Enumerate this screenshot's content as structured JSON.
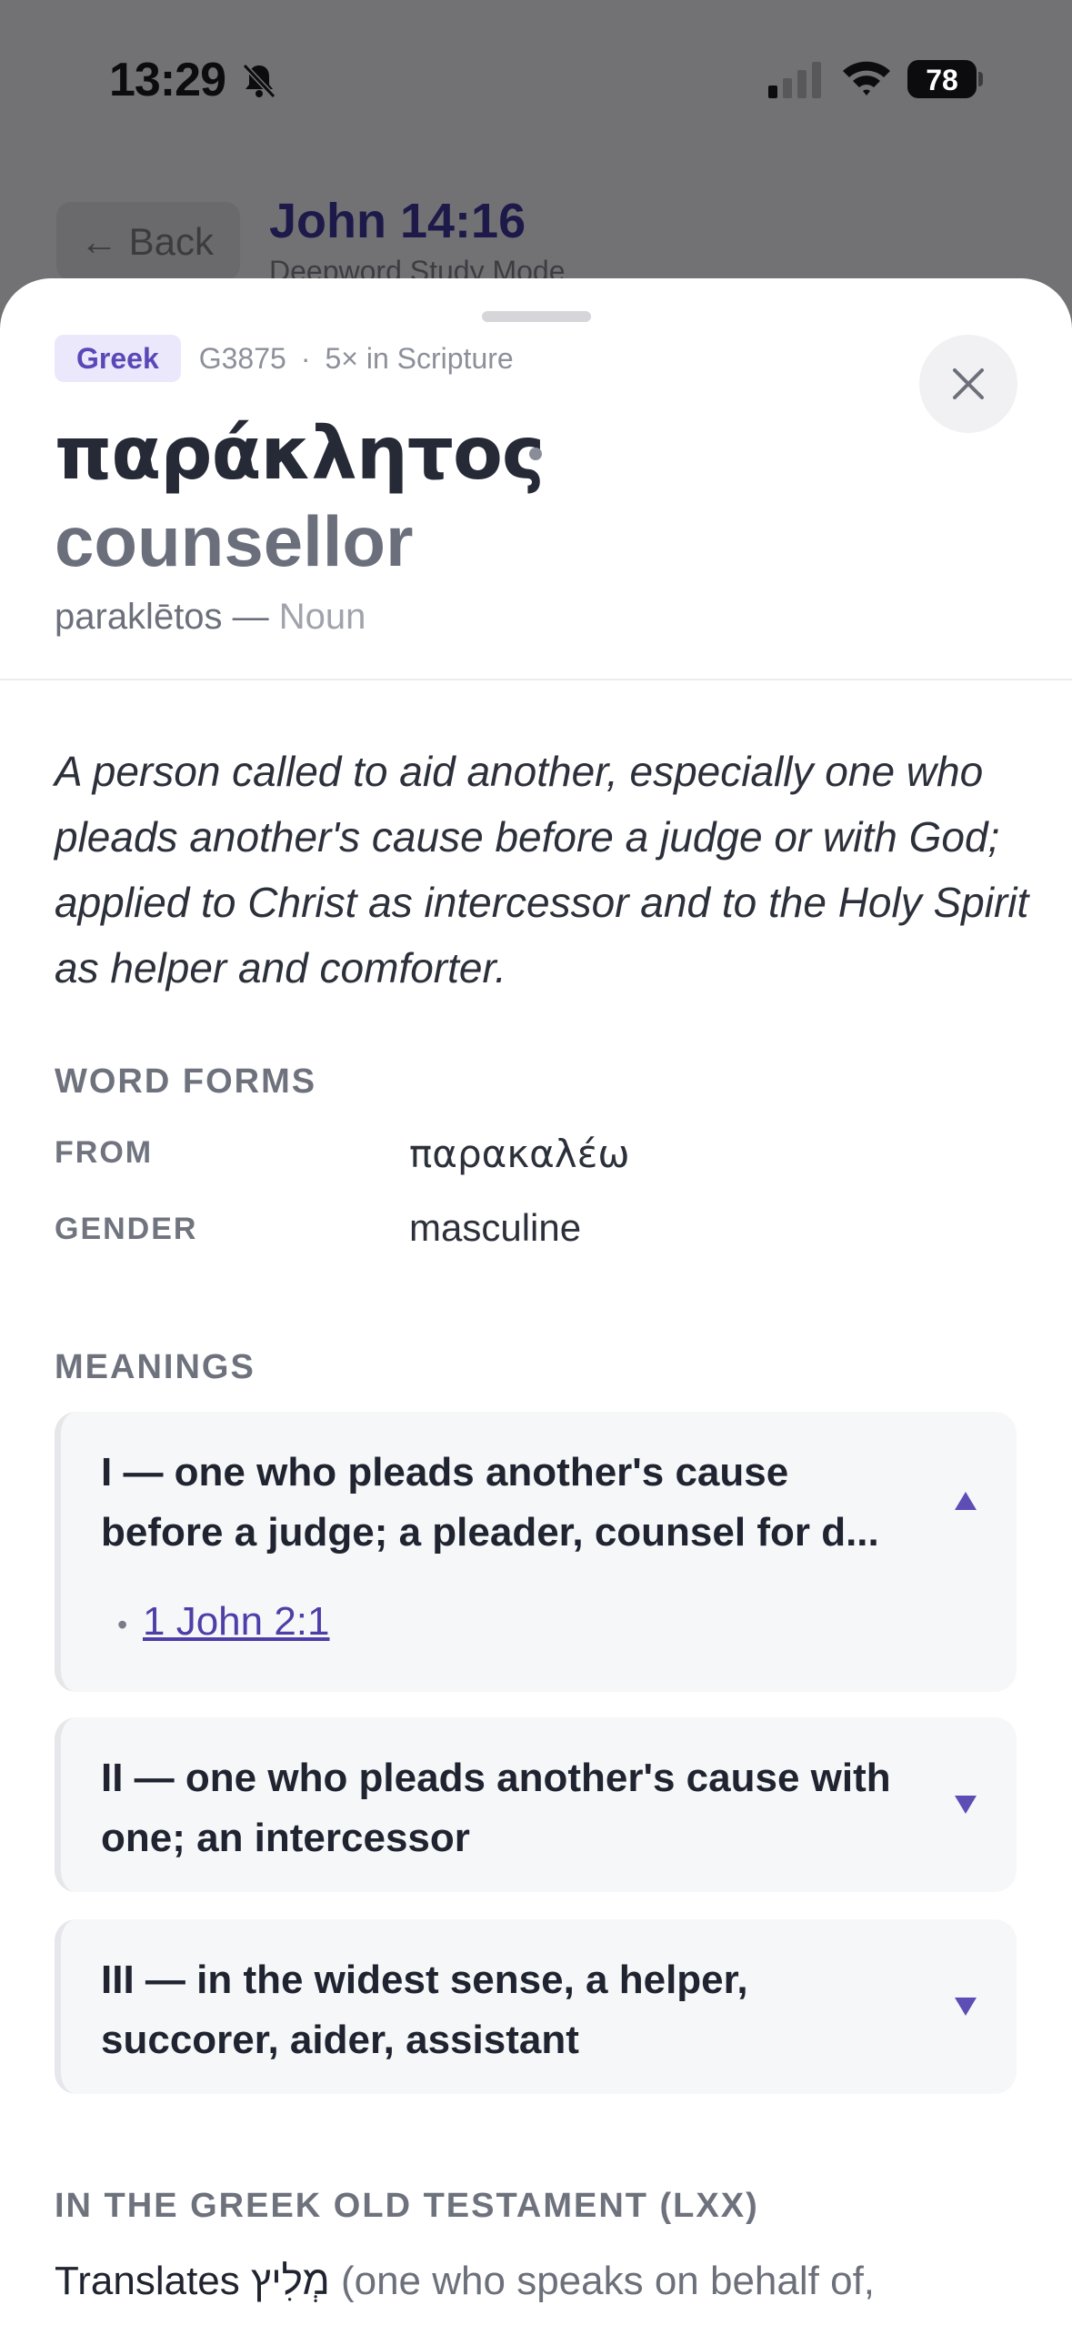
{
  "status_bar": {
    "time": "13:29",
    "battery": "78"
  },
  "background": {
    "back_label": "← Back",
    "title": "John 14:16",
    "subtitle": "Deepword Study Mode"
  },
  "sheet": {
    "language_badge": "Greek",
    "strongs": "G3875",
    "separator": "·",
    "occurrences": "5× in Scripture",
    "headword": "παράκλητος",
    "gloss": "counsellor",
    "transliteration": "paraklētos — ",
    "part_of_speech": "Noun",
    "definition": "A person called to aid another, especially one who pleads another's cause before a judge or with God; applied to Christ as intercessor and to the Holy Spirit as helper and comforter.",
    "word_forms": {
      "label": "WORD FORMS",
      "from_key": "FROM",
      "from_value": "παρακαλέω",
      "gender_key": "GENDER",
      "gender_value": "masculine"
    },
    "meanings": {
      "label": "MEANINGS",
      "items": [
        {
          "text": "I — one who pleads another's cause before a judge; a pleader, counsel for d...",
          "expanded": true,
          "ref_bullet": "•",
          "ref": "1 John 2:1"
        },
        {
          "text": "II — one who pleads another's cause with one; an intercessor",
          "expanded": false
        },
        {
          "text": "III — in the widest sense, a helper, succorer, aider, assistant",
          "expanded": false
        }
      ]
    },
    "lxx": {
      "label": "IN THE GREEK OLD TESTAMENT (LXX)",
      "translates": "Translates ",
      "hebrew": "מְלִיץ",
      "explanation": " (one who speaks on behalf of, advocate)"
    }
  },
  "colors": {
    "accent": "#5b48b8",
    "badge_bg": "#ece8fb",
    "caret": "#5e4db4"
  }
}
